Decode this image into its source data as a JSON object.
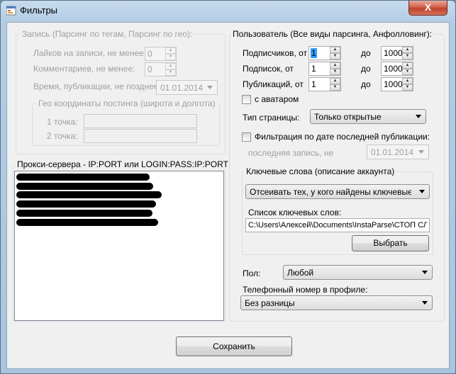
{
  "window": {
    "title": "Фильтры",
    "close_label": "X"
  },
  "post_group": {
    "title": "Запись (Парсинг по тегам, Парсинг по гео):",
    "likes_label": "Лайков на записи, не менее:",
    "likes_value": "0",
    "comments_label": "Комментариев, не менее:",
    "comments_value": "0",
    "time_label": "Время, публикации, не позднее",
    "time_value": "01.01.2014",
    "geo_group": {
      "title": "Гео координаты постинга (широта и долгота)",
      "point1_label": "1 точка:",
      "point2_label": "2 точка:"
    }
  },
  "proxy_group": {
    "title": "Прокси-сервера - IP:PORT или LOGIN:PASS:IP:PORT"
  },
  "user_group": {
    "title": "Пользователь (Все виды парсинга, Анфолловинг):",
    "followers_label": "Подписчиков, от",
    "followers_from": "1",
    "followers_to": "1000",
    "following_label": "Подписок, от",
    "following_from": "1",
    "following_to": "1000",
    "posts_label": "Публикаций, от",
    "posts_from": "1",
    "posts_to": "1000",
    "to_label": "до",
    "avatar_label": "с аватаром",
    "page_type_label": "Тип страницы:",
    "page_type_value": "Только открытые",
    "date_filter_label": "Фильтрация по дате последней публикации:",
    "last_post_label": "последняя запись, не",
    "last_post_value": "01.01.2014",
    "keywords_group": {
      "title": "Ключевые слова (описание аккаунта)",
      "mode_value": "Отсеивать тех, у кого найдены ключевые слова",
      "list_label": "Список ключевых слов:",
      "path_value": "C:\\Users\\Алексей\\Documents\\InstaParse\\СТОП СЛОВА.txt",
      "choose_button": "Выбрать"
    },
    "gender_label": "Пол:",
    "gender_value": "Любой",
    "phone_label": "Телефонный номер в профиле:",
    "phone_value": "Без разницы"
  },
  "save_button": "Сохранить"
}
